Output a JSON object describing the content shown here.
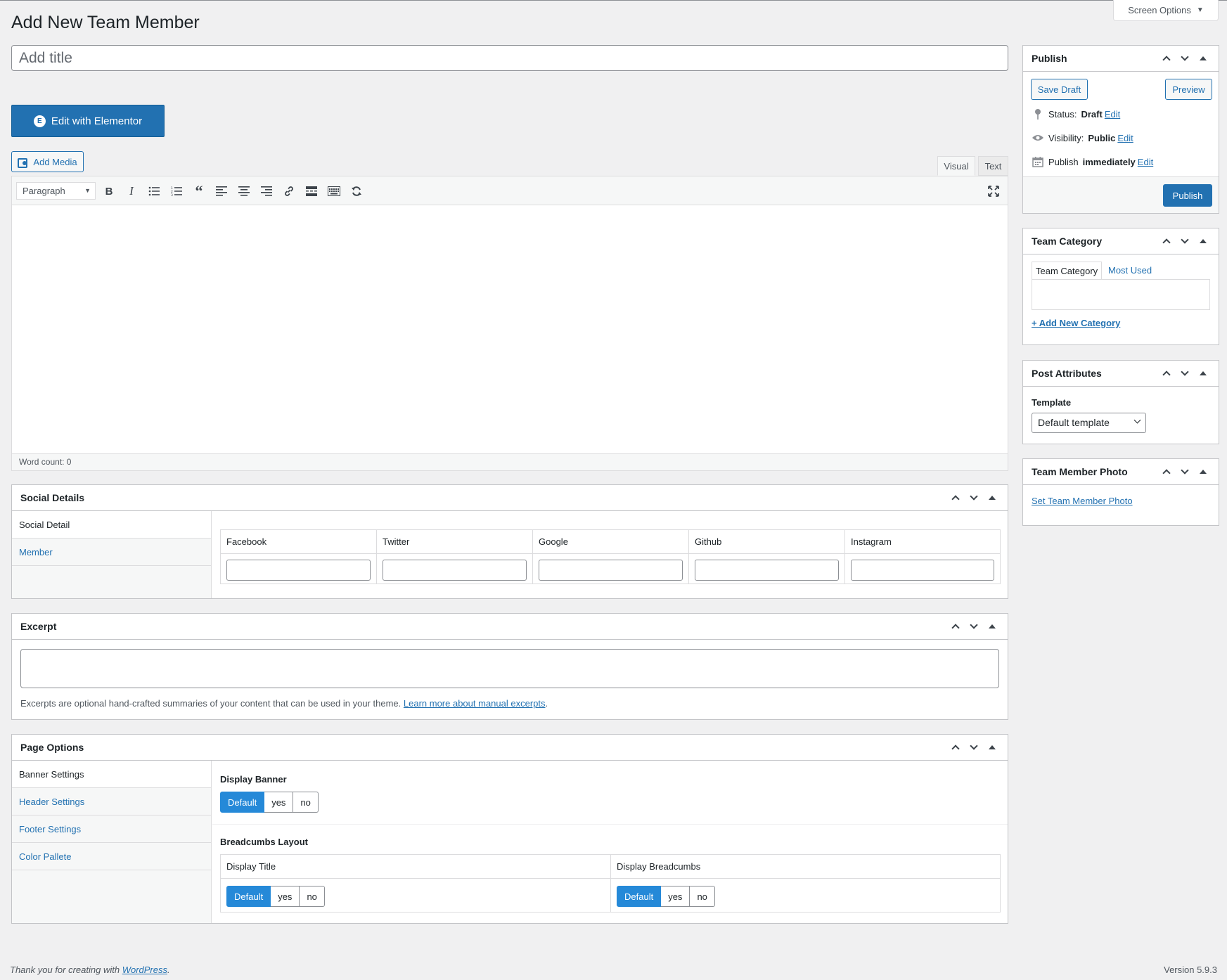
{
  "page": {
    "title": "Add New Team Member",
    "screen_options": "Screen Options",
    "title_placeholder": "Add title"
  },
  "editor": {
    "elementor_label": "Edit with Elementor",
    "add_media_label": "Add Media",
    "tabs": [
      "Visual",
      "Text"
    ],
    "format_select": "Paragraph",
    "toolbar_icons": [
      "bold-icon",
      "italic-icon",
      "bulleted-list-icon",
      "numbered-list-icon",
      "blockquote-icon",
      "align-left-icon",
      "align-center-icon",
      "align-right-icon",
      "link-icon",
      "read-more-icon",
      "toolbar-toggle-icon",
      "refresh-icon"
    ],
    "word_count": "Word count: 0"
  },
  "social": {
    "title": "Social Details",
    "tabs": [
      "Social Detail",
      "Member"
    ],
    "columns": [
      "Facebook",
      "Twitter",
      "Google",
      "Github",
      "Instagram"
    ]
  },
  "excerpt": {
    "title": "Excerpt",
    "help": "Excerpts are optional hand-crafted summaries of your content that can be used in your theme.",
    "link": "Learn more about manual excerpts",
    "period": "."
  },
  "page_options": {
    "title": "Page Options",
    "tabs": [
      "Banner Settings",
      "Header Settings",
      "Footer Settings",
      "Color Pallete"
    ],
    "display_banner": "Display Banner",
    "breadcrumbs_layout": "Breadcumbs Layout",
    "display_title": "Display Title",
    "display_breadcrumbs": "Display Breadcumbs",
    "choices": [
      "Default",
      "yes",
      "no"
    ]
  },
  "publish": {
    "title": "Publish",
    "save_draft": "Save Draft",
    "preview": "Preview",
    "status_label": "Status:",
    "status_value": "Draft",
    "visibility_label": "Visibility:",
    "visibility_value": "Public",
    "publish_label": "Publish",
    "publish_value": "immediately",
    "edit": "Edit",
    "publish_button": "Publish"
  },
  "team_category": {
    "title": "Team Category",
    "tabs": [
      "Team Category",
      "Most Used"
    ],
    "add_new": "+ Add New Category"
  },
  "post_attributes": {
    "title": "Post Attributes",
    "template_label": "Template",
    "template_value": "Default template"
  },
  "team_photo": {
    "title": "Team Member Photo",
    "link": "Set Team Member Photo"
  },
  "footer": {
    "thanks": "Thank you for creating with",
    "wp_link": "WordPress",
    "period": ".",
    "version": "Version 5.9.3"
  },
  "colors": {
    "primary": "#2271b1",
    "toggle_active": "#2589d8",
    "background": "#f0f0f1"
  }
}
